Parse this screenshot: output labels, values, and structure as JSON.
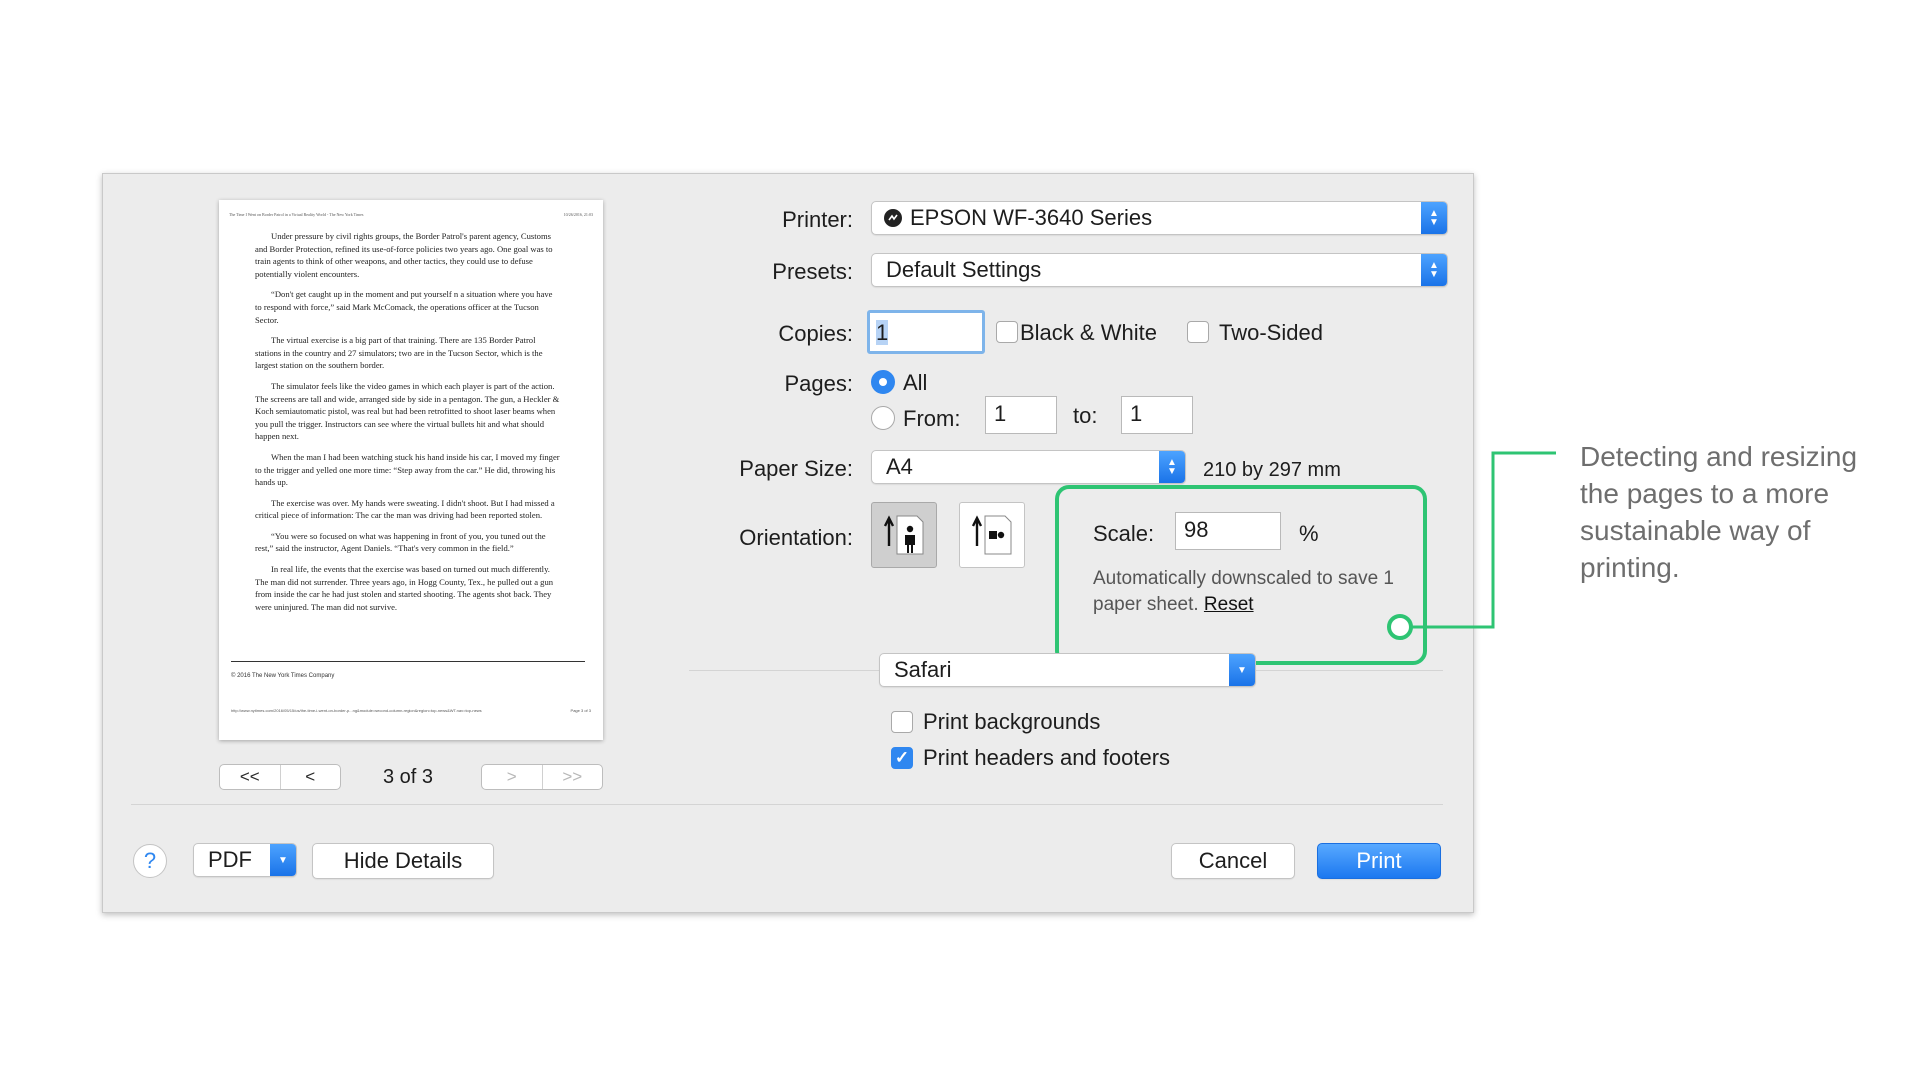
{
  "preview": {
    "header_left": "The Time I Went on Border Patrol in a Virtual Reality World - The New York Times",
    "header_right": "10/26/2016, 21:03",
    "paragraphs": [
      "Under pressure by civil rights groups, the Border Patrol's parent agency, Customs and Border Protection, refined its use-of-force policies two years ago. One goal was to train agents to think of other weapons, and other tactics, they could use to defuse potentially violent encounters.",
      "“Don't get caught up in the moment and put yourself n a situation where you have to respond with force,” said Mark McComack, the operations officer at the Tucson Sector.",
      "The virtual exercise is a big part of that training. There are 135 Border Patrol stations in the country and 27 simulators; two are in the Tucson Sector, which is the largest station on the southern border.",
      "The simulator feels like the video games in which each player is part of the action. The screens are tall and wide, arranged side by side in a pentagon. The gun, a Heckler & Koch semiautomatic pistol, was real but had been retrofitted to shoot laser beams when you pull the trigger. Instructors can see where the virtual bullets hit and what should happen next.",
      "When the man I had been watching stuck his hand inside his car, I moved my finger to the trigger and yelled one more time: “Step away from the car.” He did, throwing his hands up.",
      "The exercise was over. My hands were sweating. I didn't shoot. But I had missed a critical piece of information: The car the man was driving had been reported stolen.",
      "“You were so focused on what was happening in front of you, you tuned out the rest,” said the instructor, Agent Daniels. “That's very common in the field.”",
      "In real life, the events that the exercise was based on turned out much differently. The man did not surrender. Three years ago, in Hogg County, Tex., he pulled out a gun from inside the car he had just stolen and started shooting. The agents shot back. They were uninjured. The man did not survive."
    ],
    "copyright": "© 2016 The New York Times Company",
    "footer_left": "http://www.nytimes.com/2016/05/15/us/the-time-i-went-on-border-p...ng&module=second-column-region&region=top-news&WT.nav=top-news",
    "footer_right": "Page 3 of 3"
  },
  "nav": {
    "first": "<<",
    "prev": "<",
    "next": ">",
    "last": ">>",
    "page_count": "3 of 3"
  },
  "printer": {
    "label": "Printer:",
    "value": "EPSON WF-3640 Series"
  },
  "presets": {
    "label": "Presets:",
    "value": "Default Settings"
  },
  "copies": {
    "label": "Copies:",
    "value": "1",
    "bw_label": "Black & White",
    "bw_checked": false,
    "two_sided_label": "Two-Sided",
    "two_sided_checked": false
  },
  "pages": {
    "label": "Pages:",
    "all_label": "All",
    "from_label": "From:",
    "from_value": "1",
    "to_label": "to:",
    "to_value": "1",
    "selected": "All"
  },
  "paper_size": {
    "label": "Paper Size:",
    "value": "A4",
    "dimensions": "210 by 297 mm"
  },
  "orientation": {
    "label": "Orientation:",
    "selected": "portrait"
  },
  "scale": {
    "label": "Scale:",
    "value": "98",
    "unit": "%",
    "note": "Automatically downscaled to save 1 paper sheet.",
    "reset_label": "Reset"
  },
  "app_section": {
    "value": "Safari"
  },
  "options": [
    {
      "label": "Print backgrounds",
      "checked": false
    },
    {
      "label": "Print headers and footers",
      "checked": true
    }
  ],
  "footer": {
    "help": "?",
    "pdf_label": "PDF",
    "hide_details_label": "Hide Details",
    "cancel_label": "Cancel",
    "print_label": "Print"
  },
  "annotation": "Detecting and resizing the pages to a more sustainable way of printing.",
  "colors": {
    "accent": "#2f87f0",
    "highlight": "#2ec473",
    "dialog_bg": "#ececec"
  }
}
